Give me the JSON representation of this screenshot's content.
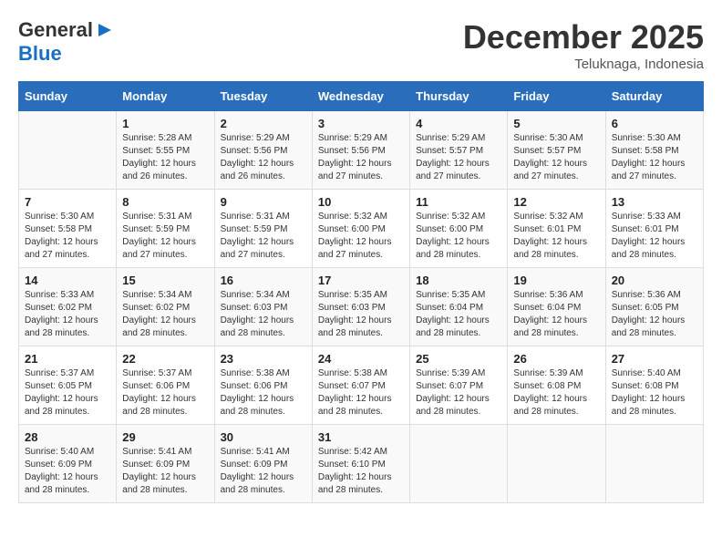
{
  "header": {
    "logo_general": "General",
    "logo_blue": "Blue",
    "month": "December 2025",
    "location": "Teluknaga, Indonesia"
  },
  "days_of_week": [
    "Sunday",
    "Monday",
    "Tuesday",
    "Wednesday",
    "Thursday",
    "Friday",
    "Saturday"
  ],
  "weeks": [
    [
      {
        "day": "",
        "info": ""
      },
      {
        "day": "1",
        "info": "Sunrise: 5:28 AM\nSunset: 5:55 PM\nDaylight: 12 hours and 26 minutes."
      },
      {
        "day": "2",
        "info": "Sunrise: 5:29 AM\nSunset: 5:56 PM\nDaylight: 12 hours and 26 minutes."
      },
      {
        "day": "3",
        "info": "Sunrise: 5:29 AM\nSunset: 5:56 PM\nDaylight: 12 hours and 27 minutes."
      },
      {
        "day": "4",
        "info": "Sunrise: 5:29 AM\nSunset: 5:57 PM\nDaylight: 12 hours and 27 minutes."
      },
      {
        "day": "5",
        "info": "Sunrise: 5:30 AM\nSunset: 5:57 PM\nDaylight: 12 hours and 27 minutes."
      },
      {
        "day": "6",
        "info": "Sunrise: 5:30 AM\nSunset: 5:58 PM\nDaylight: 12 hours and 27 minutes."
      }
    ],
    [
      {
        "day": "7",
        "info": "Sunrise: 5:30 AM\nSunset: 5:58 PM\nDaylight: 12 hours and 27 minutes."
      },
      {
        "day": "8",
        "info": "Sunrise: 5:31 AM\nSunset: 5:59 PM\nDaylight: 12 hours and 27 minutes."
      },
      {
        "day": "9",
        "info": "Sunrise: 5:31 AM\nSunset: 5:59 PM\nDaylight: 12 hours and 27 minutes."
      },
      {
        "day": "10",
        "info": "Sunrise: 5:32 AM\nSunset: 6:00 PM\nDaylight: 12 hours and 27 minutes."
      },
      {
        "day": "11",
        "info": "Sunrise: 5:32 AM\nSunset: 6:00 PM\nDaylight: 12 hours and 28 minutes."
      },
      {
        "day": "12",
        "info": "Sunrise: 5:32 AM\nSunset: 6:01 PM\nDaylight: 12 hours and 28 minutes."
      },
      {
        "day": "13",
        "info": "Sunrise: 5:33 AM\nSunset: 6:01 PM\nDaylight: 12 hours and 28 minutes."
      }
    ],
    [
      {
        "day": "14",
        "info": "Sunrise: 5:33 AM\nSunset: 6:02 PM\nDaylight: 12 hours and 28 minutes."
      },
      {
        "day": "15",
        "info": "Sunrise: 5:34 AM\nSunset: 6:02 PM\nDaylight: 12 hours and 28 minutes."
      },
      {
        "day": "16",
        "info": "Sunrise: 5:34 AM\nSunset: 6:03 PM\nDaylight: 12 hours and 28 minutes."
      },
      {
        "day": "17",
        "info": "Sunrise: 5:35 AM\nSunset: 6:03 PM\nDaylight: 12 hours and 28 minutes."
      },
      {
        "day": "18",
        "info": "Sunrise: 5:35 AM\nSunset: 6:04 PM\nDaylight: 12 hours and 28 minutes."
      },
      {
        "day": "19",
        "info": "Sunrise: 5:36 AM\nSunset: 6:04 PM\nDaylight: 12 hours and 28 minutes."
      },
      {
        "day": "20",
        "info": "Sunrise: 5:36 AM\nSunset: 6:05 PM\nDaylight: 12 hours and 28 minutes."
      }
    ],
    [
      {
        "day": "21",
        "info": "Sunrise: 5:37 AM\nSunset: 6:05 PM\nDaylight: 12 hours and 28 minutes."
      },
      {
        "day": "22",
        "info": "Sunrise: 5:37 AM\nSunset: 6:06 PM\nDaylight: 12 hours and 28 minutes."
      },
      {
        "day": "23",
        "info": "Sunrise: 5:38 AM\nSunset: 6:06 PM\nDaylight: 12 hours and 28 minutes."
      },
      {
        "day": "24",
        "info": "Sunrise: 5:38 AM\nSunset: 6:07 PM\nDaylight: 12 hours and 28 minutes."
      },
      {
        "day": "25",
        "info": "Sunrise: 5:39 AM\nSunset: 6:07 PM\nDaylight: 12 hours and 28 minutes."
      },
      {
        "day": "26",
        "info": "Sunrise: 5:39 AM\nSunset: 6:08 PM\nDaylight: 12 hours and 28 minutes."
      },
      {
        "day": "27",
        "info": "Sunrise: 5:40 AM\nSunset: 6:08 PM\nDaylight: 12 hours and 28 minutes."
      }
    ],
    [
      {
        "day": "28",
        "info": "Sunrise: 5:40 AM\nSunset: 6:09 PM\nDaylight: 12 hours and 28 minutes."
      },
      {
        "day": "29",
        "info": "Sunrise: 5:41 AM\nSunset: 6:09 PM\nDaylight: 12 hours and 28 minutes."
      },
      {
        "day": "30",
        "info": "Sunrise: 5:41 AM\nSunset: 6:09 PM\nDaylight: 12 hours and 28 minutes."
      },
      {
        "day": "31",
        "info": "Sunrise: 5:42 AM\nSunset: 6:10 PM\nDaylight: 12 hours and 28 minutes."
      },
      {
        "day": "",
        "info": ""
      },
      {
        "day": "",
        "info": ""
      },
      {
        "day": "",
        "info": ""
      }
    ]
  ]
}
